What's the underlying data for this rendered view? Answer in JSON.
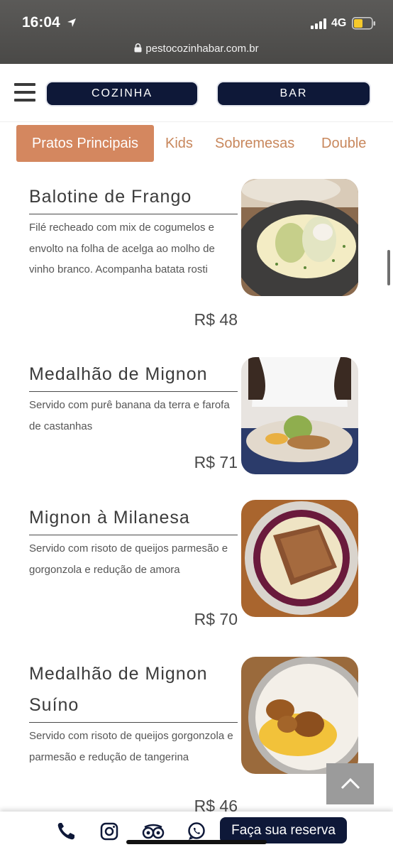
{
  "status_bar": {
    "time": "16:04",
    "network": "4G",
    "url": "pestocozinhabar.com.br"
  },
  "nav": {
    "menu_icon": "hamburger-icon",
    "tabs": [
      {
        "label": "COZINHA"
      },
      {
        "label": "BAR"
      }
    ]
  },
  "categories": [
    {
      "label": "Pratos Principais",
      "active": true
    },
    {
      "label": "Kids"
    },
    {
      "label": "Sobremesas"
    },
    {
      "label": "Double"
    }
  ],
  "colors": {
    "accent": "#d4875f",
    "navy": "#0e1838"
  },
  "dishes": [
    {
      "title": "Balotine de Frango",
      "description": "Filé recheado com mix de cogumelos e envolto na folha de acelga ao molho de vinho branco. Acompanha batata rosti",
      "price": "R$ 48"
    },
    {
      "title": "Medalhão de Mignon",
      "description": "Servido com purê banana da terra e farofa de castanhas",
      "price": "R$ 71"
    },
    {
      "title": "Mignon à Milanesa",
      "description": "Servido com risoto de queijos parmesão e gorgonzola e redução de amora",
      "price": "R$ 70"
    },
    {
      "title_line1": "Medalhão de Mignon",
      "title_line2": "Suíno",
      "description": "Servido com risoto de queijos gorgonzola e parmesão e redução de tangerina",
      "price": "R$ 46"
    }
  ],
  "bottom_bar": {
    "icons": [
      "phone-icon",
      "instagram-icon",
      "tripadvisor-icon",
      "whatsapp-icon"
    ],
    "reserve_label": "Faça sua reserva"
  }
}
